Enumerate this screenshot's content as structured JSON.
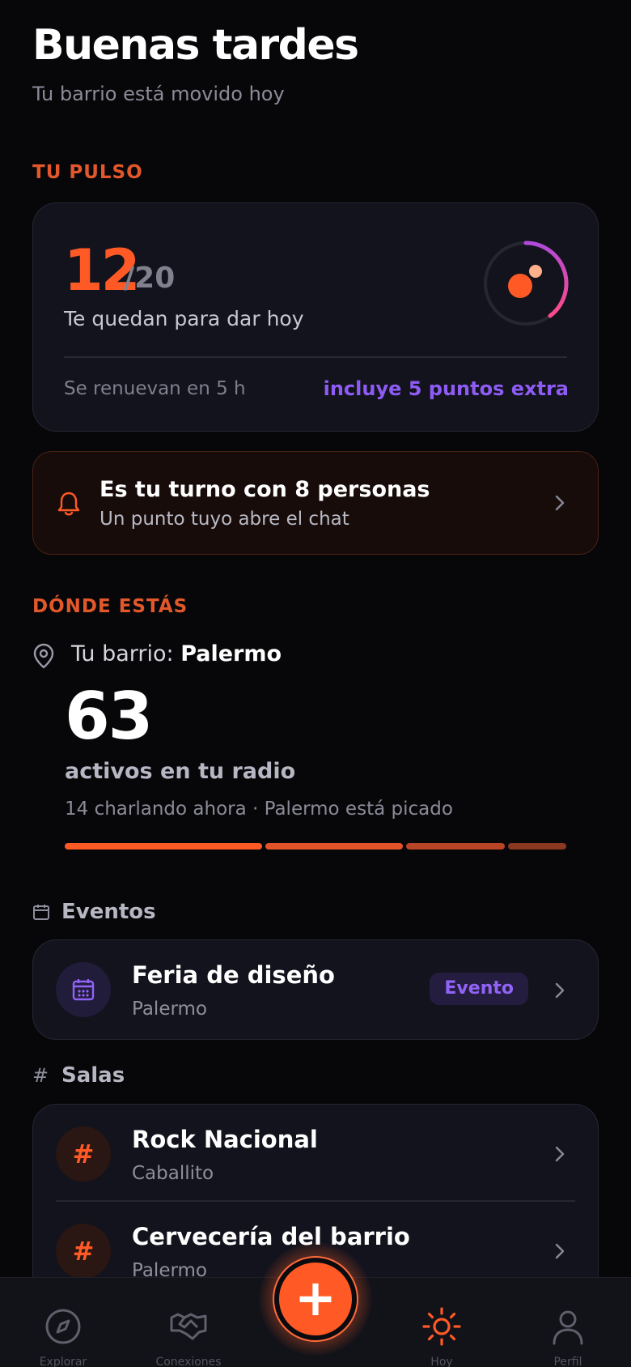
{
  "header": {
    "greeting": "Buenas tardes",
    "subtitle": "Tu barrio está movido hoy"
  },
  "pulse": {
    "section_label": "TU PULSO",
    "remaining": "12",
    "total": "/20",
    "remaining_fraction": 0.6,
    "description": "Te quedan para dar hoy",
    "renew_text": "Se renuevan en 5 h",
    "extra_text": "incluye 5 puntos extra"
  },
  "turn_banner": {
    "title": "Es tu turno con 8 personas",
    "subtitle": "Un punto tuyo abre el chat"
  },
  "location": {
    "section_label": "DÓNDE ESTÁS",
    "barrio_prefix": "Tu barrio: ",
    "barrio_name": "Palermo",
    "active_count": "63",
    "active_label": "activos en tu radio",
    "activity_text": "14 charlando ahora · Palermo está picado"
  },
  "events": {
    "group_title": "Eventos",
    "items": [
      {
        "title": "Feria de diseño",
        "subtitle": "Palermo",
        "badge": "Evento"
      }
    ]
  },
  "rooms": {
    "group_title": "Salas",
    "group_icon": "#",
    "items": [
      {
        "title": "Rock Nacional",
        "subtitle": "Caballito",
        "icon": "#"
      },
      {
        "title": "Cervecería del barrio",
        "subtitle": "Palermo",
        "icon": "#"
      }
    ]
  },
  "fab": {
    "icon": "+"
  },
  "tabbar": {
    "tabs": [
      {
        "icon": "compass-icon",
        "label": "Explorar",
        "active": false
      },
      {
        "icon": "handshake-icon",
        "label": "Conexiones",
        "active": false
      },
      {
        "icon": "sun-icon",
        "label": "Hoy",
        "active": true
      },
      {
        "icon": "user-icon",
        "label": "Perfil",
        "active": false
      }
    ]
  },
  "colors": {
    "accent": "#ff5a26",
    "purple": "#8e5cf5",
    "background": "#070709",
    "card": "#13131d"
  }
}
